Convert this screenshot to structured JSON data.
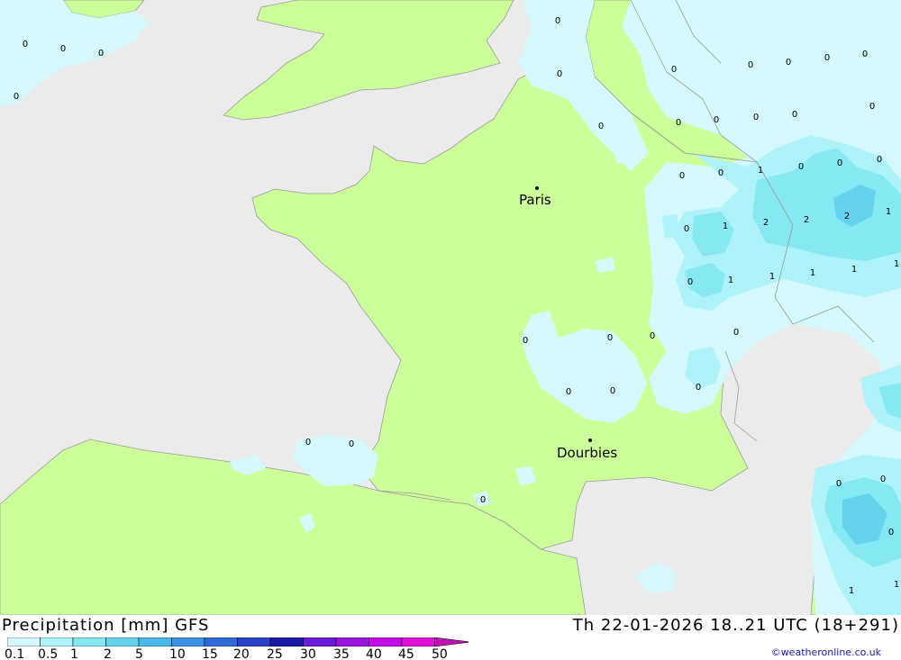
{
  "map": {
    "colors": {
      "sea": "#ebebeb",
      "land": "#ccff99",
      "precip_01": "#d4f8fb",
      "precip_05": "#aef3f9",
      "precip_1": "#86e8f3",
      "precip_2": "#66d3ee"
    },
    "cities": [
      {
        "name": "Paris"
      },
      {
        "name": "Dourbies"
      }
    ],
    "value_labels": [
      "0",
      "0",
      "0",
      "0",
      "0",
      "0",
      "0",
      "0",
      "0",
      "0",
      "0",
      "0",
      "0",
      "0",
      "0",
      "0",
      "0",
      "0",
      "0",
      "1",
      "0",
      "0",
      "0",
      "0",
      "1",
      "2",
      "2",
      "2",
      "1",
      "0",
      "1",
      "1",
      "1",
      "1",
      "1",
      "0",
      "0",
      "0",
      "0",
      "0",
      "0",
      "0",
      "0",
      "0",
      "0",
      "0",
      "0",
      "0",
      "1",
      "1",
      "2",
      "0",
      "0"
    ]
  },
  "footer": {
    "title": "Precipitation [mm] GFS",
    "valid": "Th 22-01-2026 18..21 UTC (18+291)",
    "credit": "©weatheronline.co.uk"
  },
  "legend": {
    "ticks": [
      "0.1",
      "0.5",
      "1",
      "2",
      "5",
      "10",
      "15",
      "20",
      "25",
      "30",
      "35",
      "40",
      "45",
      "50"
    ],
    "colors": [
      "#d4f8fb",
      "#aef3f9",
      "#86e8f3",
      "#66d3ee",
      "#4ab8e8",
      "#3a8fe0",
      "#2f6ad8",
      "#2a42c8",
      "#1a1aa6",
      "#6a1ad8",
      "#9a14e0",
      "#c40ce8",
      "#e010d8",
      "#c010b0"
    ]
  }
}
